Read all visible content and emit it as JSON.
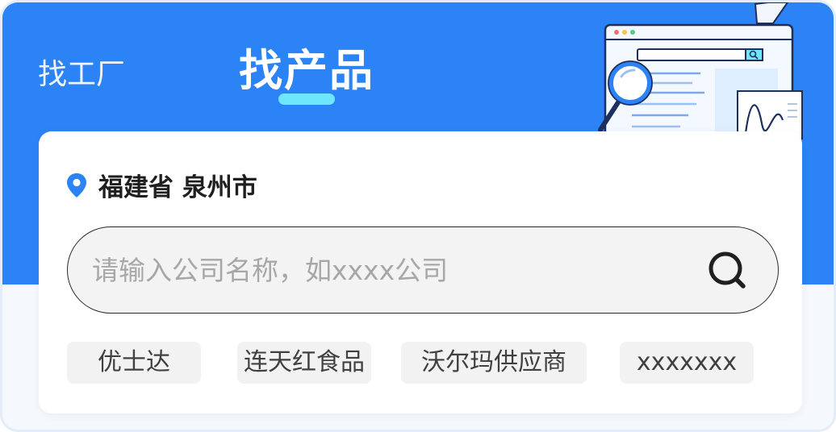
{
  "tabs": [
    {
      "label": "找工厂",
      "active": false
    },
    {
      "label": "找产品",
      "active": true
    }
  ],
  "location": {
    "label": "福建省 泉州市",
    "icon": "location-pin-icon"
  },
  "search": {
    "placeholder": "请输入公司名称，如xxxx公司",
    "value": "",
    "icon": "search-icon"
  },
  "suggestions": [
    "优士达",
    "连天红食品",
    "沃尔玛供应商",
    "xxxxxxx"
  ],
  "colors": {
    "brand_blue": "#2b83f6",
    "tab_indicator": "#6ee6fb",
    "page_background": "#f5f8fc",
    "card": "#ffffff",
    "chip_background": "#f2f2f2",
    "search_background": "#f3f3f3"
  }
}
